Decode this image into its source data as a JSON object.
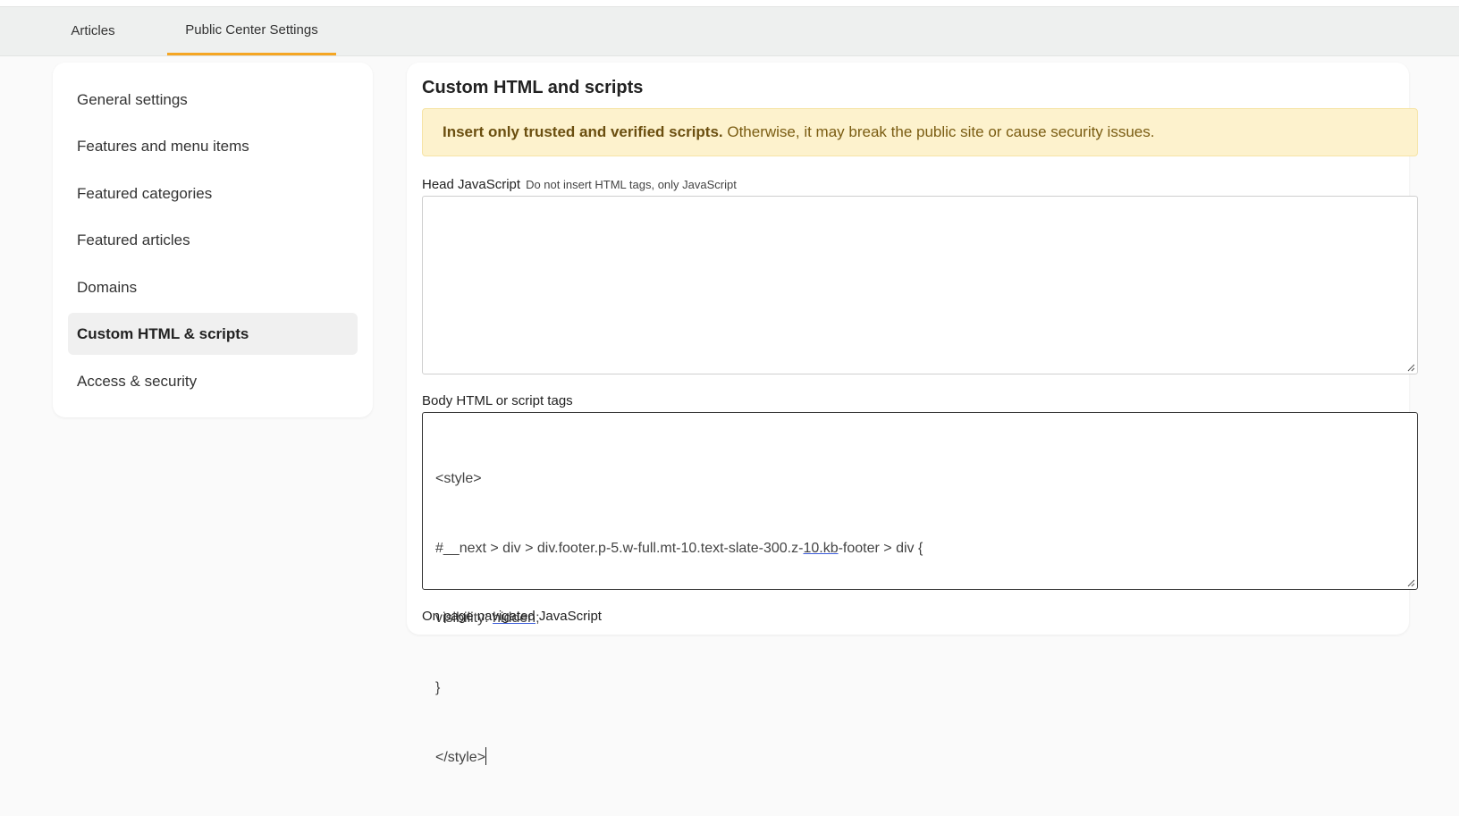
{
  "tabs": [
    {
      "label": "Articles",
      "active": false
    },
    {
      "label": "Public Center Settings",
      "active": true
    }
  ],
  "sidebar": {
    "items": [
      {
        "label": "General settings",
        "active": false
      },
      {
        "label": "Features and menu items",
        "active": false
      },
      {
        "label": "Featured categories",
        "active": false
      },
      {
        "label": "Featured articles",
        "active": false
      },
      {
        "label": "Domains",
        "active": false
      },
      {
        "label": "Custom HTML & scripts",
        "active": true
      },
      {
        "label": "Access & security",
        "active": false
      }
    ]
  },
  "main": {
    "title": "Custom HTML and scripts",
    "alert": {
      "bold": "Insert only trusted and verified scripts.",
      "text": " Otherwise, it may break the public site or cause security issues."
    },
    "head_js": {
      "label": "Head JavaScript",
      "hint": "Do not insert HTML tags, only JavaScript",
      "value": ""
    },
    "body_html": {
      "label": "Body HTML or script tags",
      "lines": {
        "l1": "<style>",
        "l2a": "#__next > div > div.footer.p-5.w-full.mt-10.text-slate-300.z-",
        "l2b": "10.kb",
        "l2c": "-footer > div {",
        "l3a": "visibility: ",
        "l3b": "hidden;",
        "l4": "}",
        "l5": "</style>"
      }
    },
    "page_nav_js": {
      "label": "On page navigated JavaScript"
    }
  },
  "colors": {
    "accent": "#f5a623",
    "alert_bg": "#fdf2cd",
    "alert_text": "#7a5c12"
  }
}
